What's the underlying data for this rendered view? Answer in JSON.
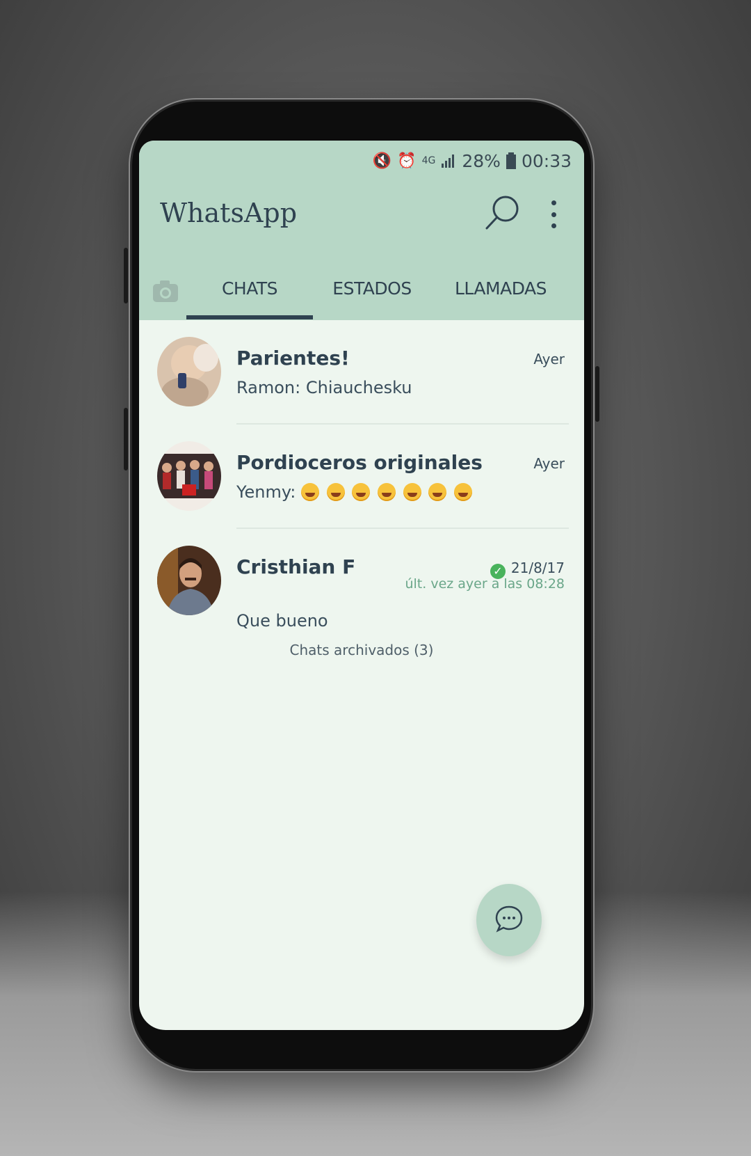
{
  "status_bar": {
    "battery": "28%",
    "time": "00:33",
    "icons": [
      "mute-icon",
      "alarm-icon",
      "4g-icon",
      "signal-icon",
      "battery-icon"
    ]
  },
  "app": {
    "title": "WhatsApp",
    "accent_color": "#b7d7c6",
    "text_color": "#2f4250"
  },
  "tabs": [
    {
      "label": "CHATS",
      "active": true
    },
    {
      "label": "ESTADOS",
      "active": false
    },
    {
      "label": "LLAMADAS",
      "active": false
    }
  ],
  "chats": [
    {
      "name": "Parientes!",
      "sender": "Ramon:",
      "message": "Chiauchesku",
      "time": "Ayer"
    },
    {
      "name": "Pordioceros originales",
      "sender": "Yenmy:",
      "message": "",
      "time": "Ayer",
      "emoji_count": 7
    },
    {
      "name": "Cristhian F",
      "message": "Que bueno",
      "time": "21/8/17",
      "last_seen": "últ. vez ayer a las 08:28",
      "verified": true
    }
  ],
  "archived": "Chats archivados (3)",
  "fab": {
    "icon": "new-chat-icon"
  }
}
